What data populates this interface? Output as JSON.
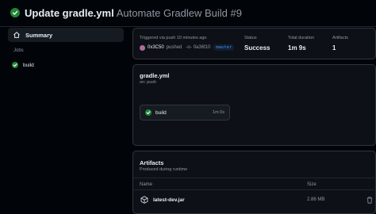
{
  "header": {
    "title": "Update gradle.yml",
    "workflow_run": "Automate Gradlew Build #9"
  },
  "sidebar": {
    "summary_label": "Summary",
    "jobs_heading": "Jobs",
    "jobs": [
      {
        "label": "build",
        "status": "success"
      }
    ]
  },
  "run_meta": {
    "trigger_text": "Triggered via push 10 minutes ago",
    "actor": "0x3C50",
    "action": "pushed",
    "commit_sha": "0a36f10",
    "branch": "master",
    "status_label": "Status",
    "status_value": "Success",
    "duration_label": "Total duration",
    "duration_value": "1m 9s",
    "artifacts_label": "Artifacts",
    "artifacts_value": "1"
  },
  "workflow_graph": {
    "file_name": "gradle.yml",
    "trigger": "on: push",
    "job": {
      "label": "build",
      "duration": "1m 0s",
      "status": "success"
    }
  },
  "artifacts": {
    "title": "Artifacts",
    "subtitle": "Produced during runtime",
    "columns": {
      "name": "Name",
      "size": "Size"
    },
    "items": [
      {
        "name": "latest-dev.jar",
        "size": "2.86 MB",
        "icon": "package-icon"
      }
    ]
  },
  "colors": {
    "success": "#238636",
    "background": "#010409",
    "panel": "#0d1117",
    "border": "#30363d",
    "muted_text": "#9198a1",
    "link": "#4493f8"
  }
}
